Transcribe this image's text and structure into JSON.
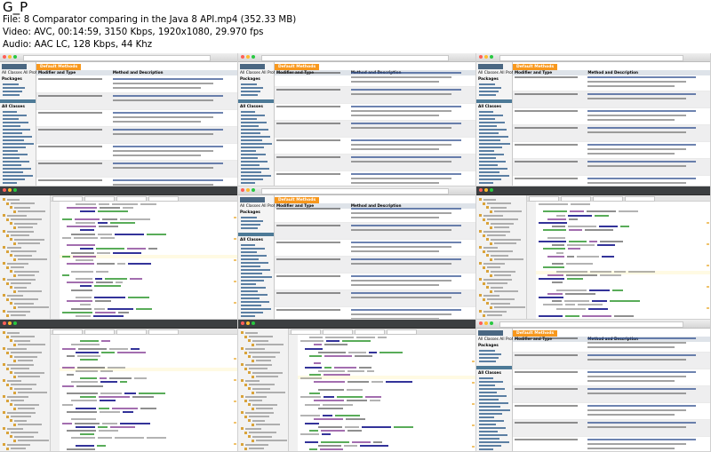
{
  "brand": "G_P",
  "file_line": "File: 8  Comparator comparing in the Java 8 API.mp4 (352.33 MB)",
  "video_line": "Video: AVC, 00:14:59, 3150 Kbps, 1920x1080, 29.970 fps",
  "audio_line": "Audio: AAC LC, 128 Kbps, 44 Khz",
  "javadoc": {
    "tab_title": "Default Methods",
    "col_modifier": "Modifier and Type",
    "col_method": "Method and Description",
    "left_header": "All Classes   All Profiles",
    "packages_label": "Packages",
    "all_classes_label": "All Classes"
  },
  "thumbnails": [
    {
      "kind": "javadoc",
      "label": "frame-1"
    },
    {
      "kind": "javadoc",
      "label": "frame-2"
    },
    {
      "kind": "javadoc",
      "label": "frame-3"
    },
    {
      "kind": "editor",
      "label": "frame-4"
    },
    {
      "kind": "javadoc",
      "label": "frame-5"
    },
    {
      "kind": "editor",
      "label": "frame-6"
    },
    {
      "kind": "editor",
      "label": "frame-7"
    },
    {
      "kind": "editor",
      "label": "frame-8"
    },
    {
      "kind": "javadoc",
      "label": "frame-9"
    }
  ],
  "colors": {
    "javadoc_accent": "#f8981d",
    "javadoc_header": "#dee3e9",
    "ide_dark": "#3c3f41",
    "keyword": "#000080"
  }
}
